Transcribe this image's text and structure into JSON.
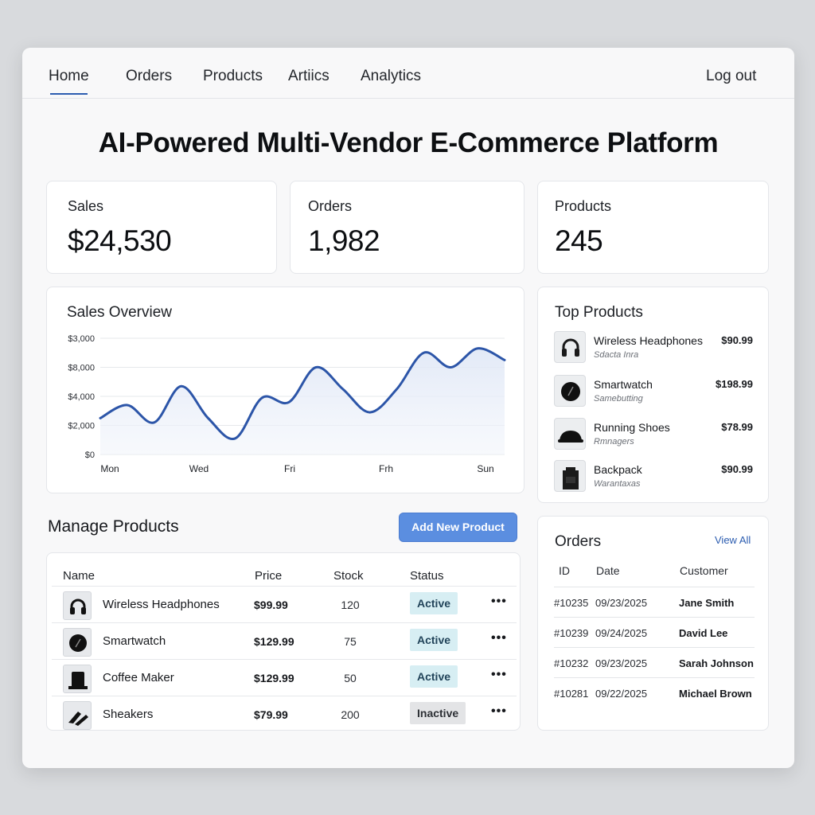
{
  "nav": {
    "items": [
      {
        "label": "Home",
        "active": true
      },
      {
        "label": "Orders"
      },
      {
        "label": "Products"
      },
      {
        "label": "Artiics"
      },
      {
        "label": "Analytics"
      }
    ],
    "logout_label": "Log out"
  },
  "page_title": "AI-Powered Multi-Vendor E-Commerce Platform",
  "kpis": [
    {
      "label": "Sales",
      "value": "$24,530"
    },
    {
      "label": "Orders",
      "value": "1,982"
    },
    {
      "label": "Products",
      "value": "245"
    }
  ],
  "sales_overview": {
    "title": "Sales Overview"
  },
  "chart_data": {
    "type": "area",
    "title": "Sales Overview",
    "y_tick_labels": [
      "$3,000",
      "$8,000",
      "$4,000",
      "$2,000",
      "$0"
    ],
    "x_tick_labels": [
      "Mon",
      "Wed",
      "Fri",
      "Frh",
      "Sun"
    ],
    "series": [
      {
        "values": [
          2500,
          3400,
          2200,
          4700,
          2500,
          1100,
          3900,
          3600,
          6000,
          4500,
          2900,
          4500,
          7000,
          6000,
          7300,
          6500
        ]
      }
    ],
    "ylim": [
      0,
      8000
    ],
    "grid": true,
    "color": "#2c55a8"
  },
  "top_products": {
    "title": "Top Products",
    "items": [
      {
        "name": "Wireless Headphones",
        "sub": "Sdacta Inra",
        "price": "$90.99",
        "icon": "headphones-icon"
      },
      {
        "name": "Smartwatch",
        "sub": "Samebutting",
        "price": "$198.99",
        "icon": "watch-icon"
      },
      {
        "name": "Running Shoes",
        "sub": "Rmnagers",
        "price": "$78.99",
        "icon": "shoe-icon"
      },
      {
        "name": "Backpack",
        "sub": "Warantaxas",
        "price": "$90.99",
        "icon": "backpack-icon"
      }
    ]
  },
  "manage_products": {
    "title": "Manage Products",
    "add_button": "Add New Product",
    "headers": [
      "Name",
      "Price",
      "Stock",
      "Status"
    ],
    "rows": [
      {
        "name": "Wireless Headphones",
        "price": "$99.99",
        "stock": "120",
        "status": "Active",
        "icon": "headphones-icon"
      },
      {
        "name": "Smartwatch",
        "price": "$129.99",
        "stock": "75",
        "status": "Active",
        "icon": "watch-icon"
      },
      {
        "name": "Coffee Maker",
        "price": "$129.99",
        "stock": "50",
        "status": "Active",
        "icon": "coffee-maker-icon"
      },
      {
        "name": "Sheakers",
        "price": "$79.99",
        "stock": "200",
        "status": "Inactive",
        "icon": "sneaker-icon"
      }
    ],
    "more_label": "•••"
  },
  "orders": {
    "title": "Orders",
    "view_all": "View All",
    "headers": [
      "ID",
      "Date",
      "Customer"
    ],
    "rows": [
      {
        "id": "#10235",
        "date": "09/23/2025",
        "customer": "Jane Smith"
      },
      {
        "id": "#10239",
        "date": "09/24/2025",
        "customer": "David Lee"
      },
      {
        "id": "#10232",
        "date": "09/23/2025",
        "customer": "Sarah Johnson"
      },
      {
        "id": "#10281",
        "date": "09/22/2025",
        "customer": "Michael Brown"
      }
    ]
  }
}
